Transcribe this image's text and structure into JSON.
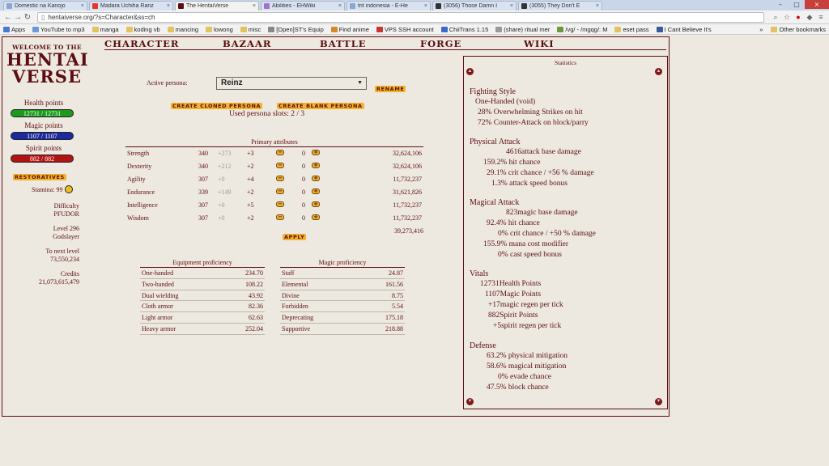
{
  "browser": {
    "tabs": [
      {
        "title": "Domestic na Kanojo",
        "fav": "#8aa6d6"
      },
      {
        "title": "Madara Uchiha Ranz",
        "fav": "#e23b2b"
      },
      {
        "title": "The HentaiVerse",
        "fav": "#5c0d11"
      },
      {
        "title": "Abilities - EHWiki",
        "fav": "#a870c8"
      },
      {
        "title": "trit indonesia - E-He",
        "fav": "#8aa6d6"
      },
      {
        "title": "(3056) Those Damn I",
        "fav": "#333"
      },
      {
        "title": "(3055) They Don't E",
        "fav": "#333"
      }
    ],
    "url": "hentaiverse.org/?s=Character&ss=ch",
    "bookmarks": [
      "Apps",
      "YouTube to mp3",
      "manga",
      "koding vb",
      "mancing",
      "lowong",
      "misc",
      "[Open]ST's Equip",
      "Find anime",
      "VPS SSH account",
      "ChiiTrans 1.15",
      "(share) ritual mer",
      "/vg/ - /mgqg/: M",
      "eset pass",
      "I Cant Believe It's"
    ],
    "other_bookmarks": "Other bookmarks"
  },
  "logo": {
    "welcome": "WELCOME TO THE",
    "line1": "HENTAI",
    "line2": "VERSE"
  },
  "nav": [
    "CHARACTER",
    "BAZAAR",
    "BATTLE",
    "FORGE",
    "WIKI"
  ],
  "sidebar": {
    "health_label": "Health points",
    "health": "12731 / 12731",
    "magic_label": "Magic points",
    "magic": "1107 / 1107",
    "spirit_label": "Spirit points",
    "spirit": "882 / 882",
    "restoratives": "RESTORATIVES",
    "stamina": "Stamina: 99",
    "difficulty_label": "Difficulty",
    "difficulty": "PFUDOR",
    "level": "Level 296",
    "title": "Godslayer",
    "next_label": "To next level",
    "next": "73,550,234",
    "credits_label": "Credits",
    "credits": "21,073,615,479"
  },
  "persona": {
    "label": "Active persona:",
    "value": "Reinz",
    "rename": "RENAME",
    "clone": "CREATE CLONED PERSONA",
    "blank": "CREATE BLANK PERSONA",
    "slots": "Used persona slots: 2 / 3"
  },
  "primary": {
    "title": "Primary attributes",
    "rows": [
      {
        "name": "Strength",
        "base": "340",
        "bonus": "+273",
        "inc": "+3",
        "val": "0",
        "exp": "32,624,106"
      },
      {
        "name": "Dexterity",
        "base": "340",
        "bonus": "+212",
        "inc": "+2",
        "val": "0",
        "exp": "32,624,106"
      },
      {
        "name": "Agility",
        "base": "307",
        "bonus": "+0",
        "inc": "+4",
        "val": "0",
        "exp": "11,732,237"
      },
      {
        "name": "Endurance",
        "base": "339",
        "bonus": "+149",
        "inc": "+2",
        "val": "0",
        "exp": "31,621,826"
      },
      {
        "name": "Intelligence",
        "base": "307",
        "bonus": "+0",
        "inc": "+5",
        "val": "0",
        "exp": "11,732,237"
      },
      {
        "name": "Wisdom",
        "base": "307",
        "bonus": "+0",
        "inc": "+2",
        "val": "0",
        "exp": "11,732,237"
      }
    ],
    "apply": "APPLY",
    "total": "39,273,416"
  },
  "equipment": {
    "title": "Equipment proficiency",
    "rows": [
      {
        "name": "One-handed",
        "val": "234.70"
      },
      {
        "name": "Two-handed",
        "val": "108.22"
      },
      {
        "name": "Dual wielding",
        "val": "43.92"
      },
      {
        "name": "Cloth armor",
        "val": "82.36"
      },
      {
        "name": "Light armor",
        "val": "62.63"
      },
      {
        "name": "Heavy armor",
        "val": "252.04"
      }
    ]
  },
  "magic": {
    "title": "Magic proficiency",
    "rows": [
      {
        "name": "Staff",
        "val": "24.87"
      },
      {
        "name": "Elemental",
        "val": "161.56"
      },
      {
        "name": "Divine",
        "val": "8.75"
      },
      {
        "name": "Forbidden",
        "val": "5.54"
      },
      {
        "name": "Deprecating",
        "val": "175.18"
      },
      {
        "name": "Supportive",
        "val": "218.88"
      }
    ]
  },
  "stats": {
    "title": "Statistics",
    "fighting_title": "Fighting Style",
    "fighting": [
      "One-Handed (void)",
      "28% Overwhelming Strikes on hit",
      "72% Counter-Attack on block/parry"
    ],
    "physical_title": "Physical Attack",
    "physical": [
      "4616attack base damage",
      "159.2% hit chance",
      "29.1% crit chance / +56 % damage",
      "1.3% attack speed bonus"
    ],
    "magical_title": "Magical Attack",
    "magical": [
      "823magic base damage",
      "92.4% hit chance",
      "0% crit chance / +50 % damage",
      "155.9% mana cost modifier",
      "0% cast speed bonus"
    ],
    "vitals_title": "Vitals",
    "vitals": [
      "12731Health Points",
      "1107Magic Points",
      "+17magic regen per tick",
      "882Spirit Points",
      "+5spirit regen per tick"
    ],
    "defense_title": "Defense",
    "defense": [
      "63.2% physical mitigation",
      "58.6% magical mitigation",
      "0% evade chance",
      "47.5% block chance"
    ]
  }
}
